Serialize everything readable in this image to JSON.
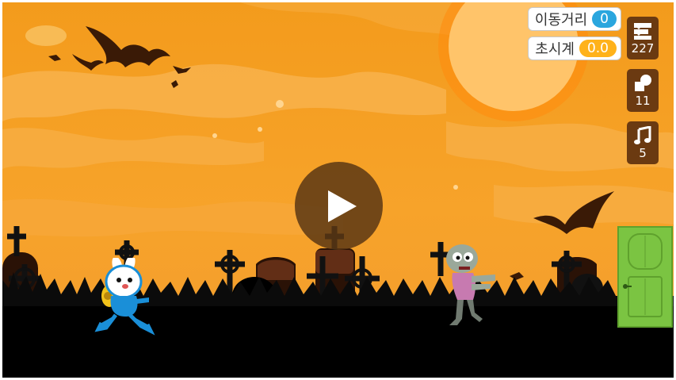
{
  "variables": [
    {
      "label": "이동거리",
      "value": "0",
      "color": "#2aa6de"
    },
    {
      "label": "초시계",
      "value": "0.0",
      "color": "#ffb21a"
    }
  ],
  "side_buttons": [
    {
      "icon": "blocks-icon",
      "count": "227"
    },
    {
      "icon": "shapes-icon",
      "count": "11"
    },
    {
      "icon": "music-note-icon",
      "count": "5"
    }
  ],
  "colors": {
    "sky": "#f39b1c",
    "moon": "#ffc064",
    "side_button": "#6b3a11",
    "door": "#7bc442"
  }
}
